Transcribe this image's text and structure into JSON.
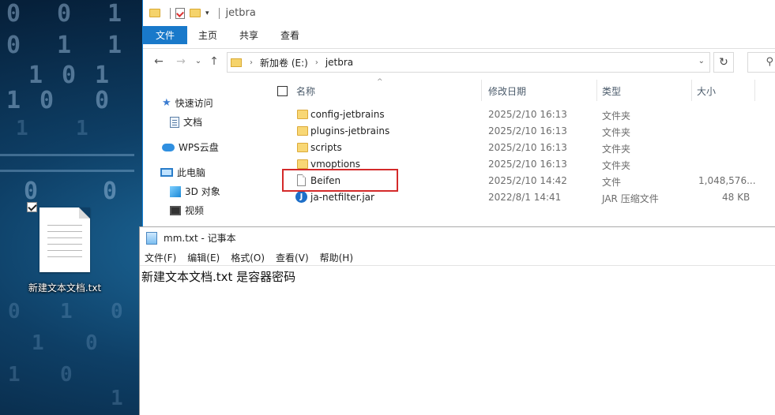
{
  "desktop": {
    "icon_label": "新建文本文档.txt"
  },
  "explorer": {
    "title": "jetbra",
    "ribbon_tabs": [
      "文件",
      "主页",
      "共享",
      "查看"
    ],
    "address": {
      "crumbs": [
        "新加卷 (E:)",
        "jetbra"
      ]
    },
    "nav": {
      "quick_access": "快速访问",
      "documents": "文档",
      "wps_cloud": "WPS云盘",
      "this_pc": "此电脑",
      "objects_3d": "3D 对象",
      "videos": "视频"
    },
    "columns": {
      "name": "名称",
      "modified": "修改日期",
      "type": "类型",
      "size": "大小"
    },
    "files": [
      {
        "name": "config-jetbrains",
        "modified": "2025/2/10 16:13",
        "type": "文件夹",
        "size": "",
        "icon": "folder-icon"
      },
      {
        "name": "plugins-jetbrains",
        "modified": "2025/2/10 16:13",
        "type": "文件夹",
        "size": "",
        "icon": "folder-icon"
      },
      {
        "name": "scripts",
        "modified": "2025/2/10 16:13",
        "type": "文件夹",
        "size": "",
        "icon": "folder-icon"
      },
      {
        "name": "vmoptions",
        "modified": "2025/2/10 16:13",
        "type": "文件夹",
        "size": "",
        "icon": "folder-icon"
      },
      {
        "name": "Beifen",
        "modified": "2025/2/10 14:42",
        "type": "文件",
        "size": "1,048,576...",
        "icon": "file-icon"
      },
      {
        "name": "ja-netfilter.jar",
        "modified": "2022/8/1 14:41",
        "type": "JAR 压缩文件",
        "size": "48 KB",
        "icon": "jar-icon"
      }
    ],
    "highlight_color": "#d42a2a"
  },
  "notepad": {
    "title": "mm.txt - 记事本",
    "menu": [
      "文件(F)",
      "编辑(E)",
      "格式(O)",
      "查看(V)",
      "帮助(H)"
    ],
    "content": "新建文本文档.txt 是容器密码"
  }
}
